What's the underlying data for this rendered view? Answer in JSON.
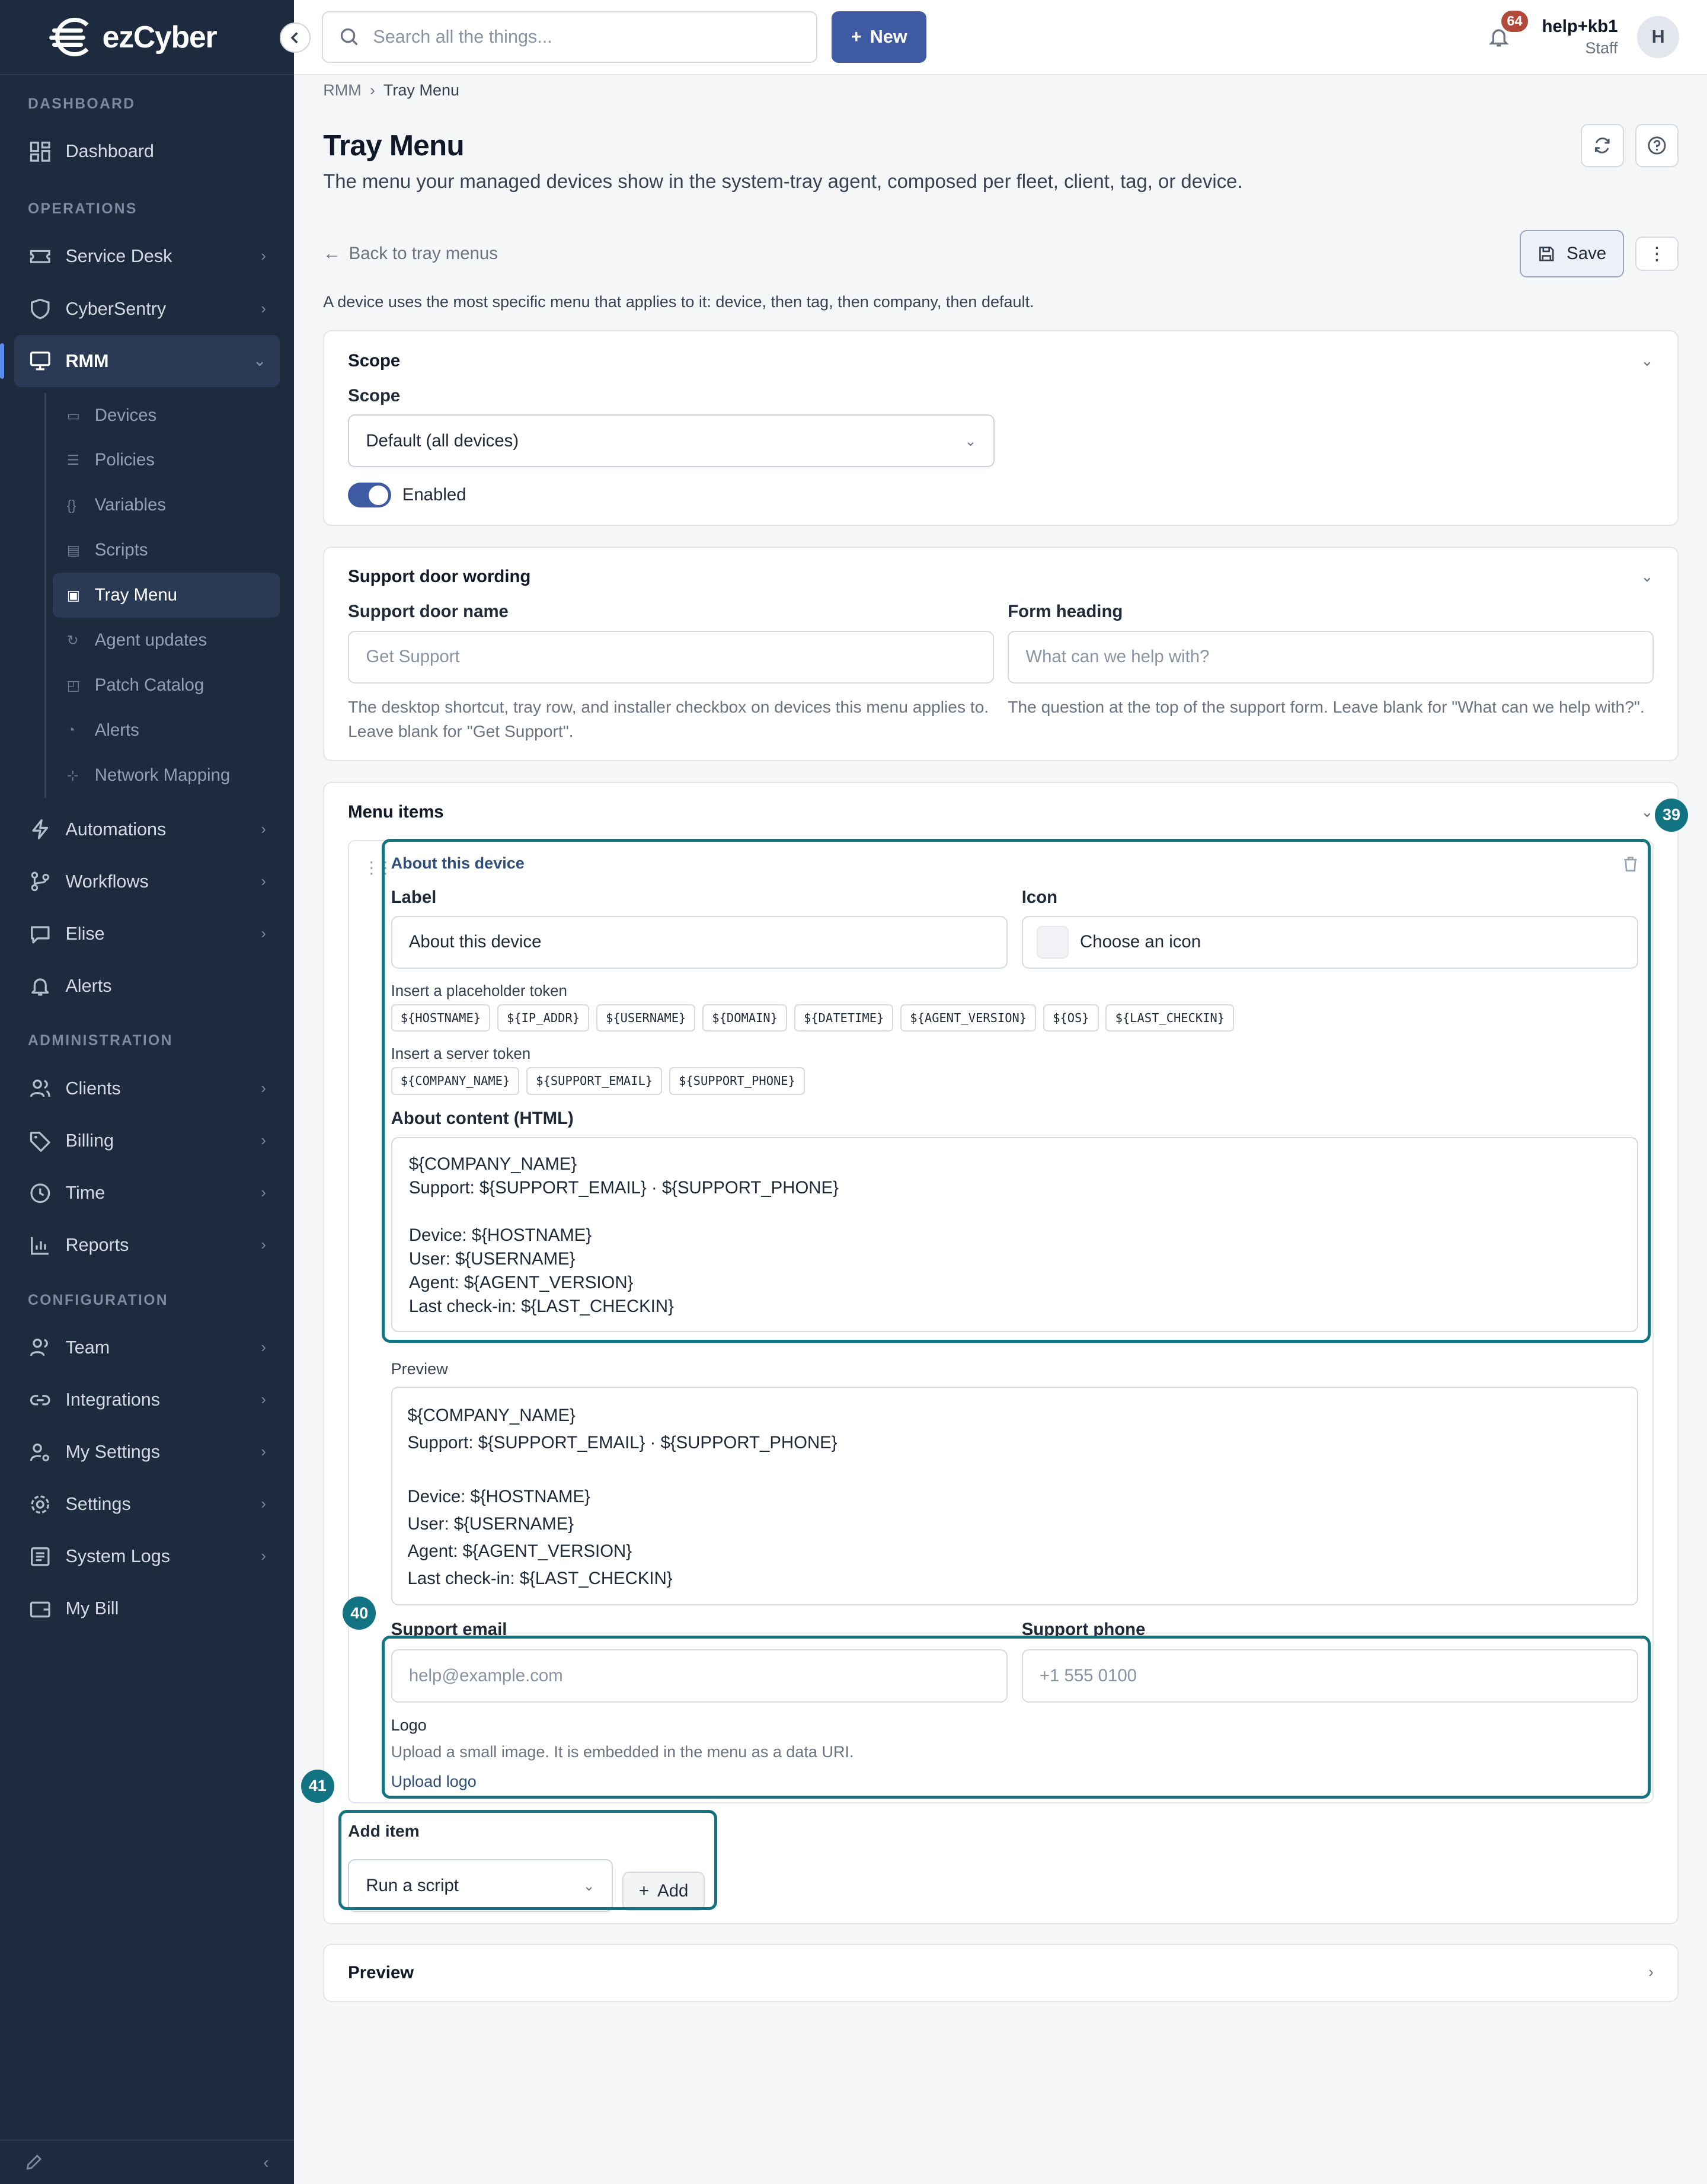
{
  "brand": {
    "name": "ezCyber"
  },
  "search": {
    "placeholder": "Search all the things..."
  },
  "topbar": {
    "new_label": "New",
    "notification_count": "64",
    "user_name": "help+kb1",
    "user_role": "Staff",
    "avatar_initial": "H"
  },
  "sidebar": {
    "sections": {
      "dashboard": "DASHBOARD",
      "operations": "OPERATIONS",
      "administration": "ADMINISTRATION",
      "configuration": "CONFIGURATION"
    },
    "items": {
      "dashboard": "Dashboard",
      "service_desk": "Service Desk",
      "cybersentry": "CyberSentry",
      "rmm": "RMM",
      "automations": "Automations",
      "workflows": "Workflows",
      "elise": "Elise",
      "alerts": "Alerts",
      "clients": "Clients",
      "billing": "Billing",
      "time": "Time",
      "reports": "Reports",
      "team": "Team",
      "integrations": "Integrations",
      "my_settings": "My Settings",
      "settings": "Settings",
      "system_logs": "System Logs",
      "my_bill": "My Bill"
    },
    "rmm_children": {
      "devices": "Devices",
      "policies": "Policies",
      "variables": "Variables",
      "scripts": "Scripts",
      "tray_menu": "Tray Menu",
      "agent_updates": "Agent updates",
      "patch_catalog": "Patch Catalog",
      "alerts": "Alerts",
      "network_mapping": "Network Mapping"
    }
  },
  "breadcrumb": {
    "parent": "RMM",
    "current": "Tray Menu"
  },
  "page": {
    "title": "Tray Menu",
    "subtitle": "The menu your managed devices show in the system-tray agent, composed per fleet, client, tag, or device.",
    "back_label": "Back to tray menus",
    "save_label": "Save",
    "explain": "A device uses the most specific menu that applies to it: device, then tag, then company, then default."
  },
  "scope": {
    "section_title": "Scope",
    "field_label": "Scope",
    "value": "Default (all devices)",
    "enabled_label": "Enabled",
    "enabled": true
  },
  "support_door": {
    "section_title": "Support door wording",
    "name_label": "Support door name",
    "name_placeholder": "Get Support",
    "name_help": "The desktop shortcut, tray row, and installer checkbox on devices this menu applies to. Leave blank for \"Get Support\".",
    "heading_label": "Form heading",
    "heading_placeholder": "What can we help with?",
    "heading_help": "The question at the top of the support form. Leave blank for \"What can we help with?\"."
  },
  "menu_items": {
    "section_title": "Menu items",
    "item": {
      "header": "About this device",
      "label_label": "Label",
      "label_value": "About this device",
      "icon_label": "Icon",
      "icon_placeholder": "Choose an icon",
      "placeholder_tokens_label": "Insert a placeholder token",
      "placeholder_tokens": [
        "${HOSTNAME}",
        "${IP_ADDR}",
        "${USERNAME}",
        "${DOMAIN}",
        "${DATETIME}",
        "${AGENT_VERSION}",
        "${OS}",
        "${LAST_CHECKIN}"
      ],
      "server_tokens_label": "Insert a server token",
      "server_tokens": [
        "${COMPANY_NAME}",
        "${SUPPORT_EMAIL}",
        "${SUPPORT_PHONE}"
      ],
      "content_label": "About content (HTML)",
      "content_value": "${COMPANY_NAME}\nSupport: ${SUPPORT_EMAIL} · ${SUPPORT_PHONE}\n\nDevice: ${HOSTNAME}\nUser: ${USERNAME}\nAgent: ${AGENT_VERSION}\nLast check-in: ${LAST_CHECKIN}",
      "preview_label": "Preview",
      "preview_value": "${COMPANY_NAME}\nSupport: ${SUPPORT_EMAIL} · ${SUPPORT_PHONE}\n\nDevice: ${HOSTNAME}\nUser: ${USERNAME}\nAgent: ${AGENT_VERSION}\nLast check-in: ${LAST_CHECKIN}",
      "email_label": "Support email",
      "email_placeholder": "help@example.com",
      "phone_label": "Support phone",
      "phone_placeholder": "+1 555 0100",
      "logo_label": "Logo",
      "logo_help": "Upload a small image. It is embedded in the menu as a data URI.",
      "upload_label": "Upload logo"
    },
    "add_item_label": "Add item",
    "add_item_type": "Run a script",
    "add_button": "Add"
  },
  "preview_section": {
    "title": "Preview"
  },
  "annotations": {
    "badge_39": "39",
    "badge_40": "40",
    "badge_41": "41",
    "color": "#127382"
  }
}
